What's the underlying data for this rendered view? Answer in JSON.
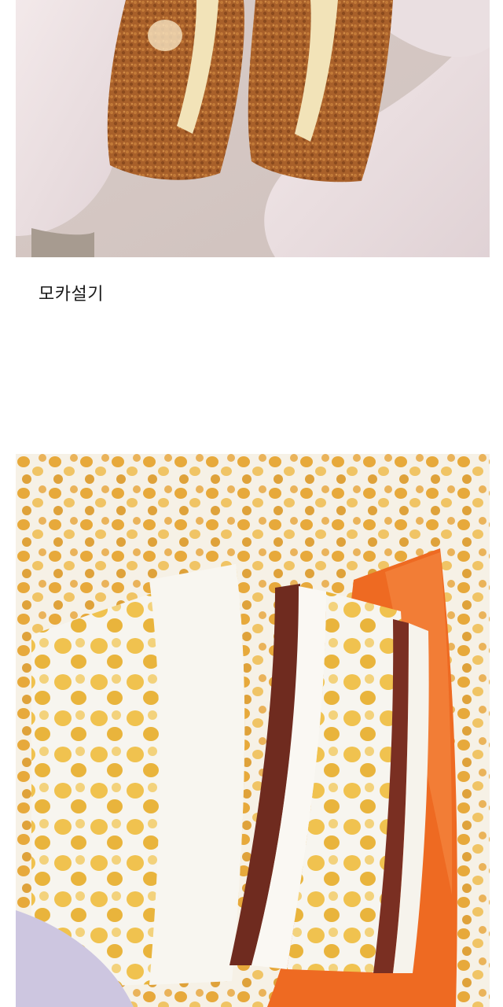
{
  "post": {
    "caption": "모카설기"
  },
  "images": {
    "top": {
      "subject": "mocha-rice-cake-photo"
    },
    "bottom": {
      "subject": "corn-rice-cake-photo"
    }
  },
  "colors": {
    "page_background": "#ffffff",
    "caption_text": "#1a1a1a"
  }
}
